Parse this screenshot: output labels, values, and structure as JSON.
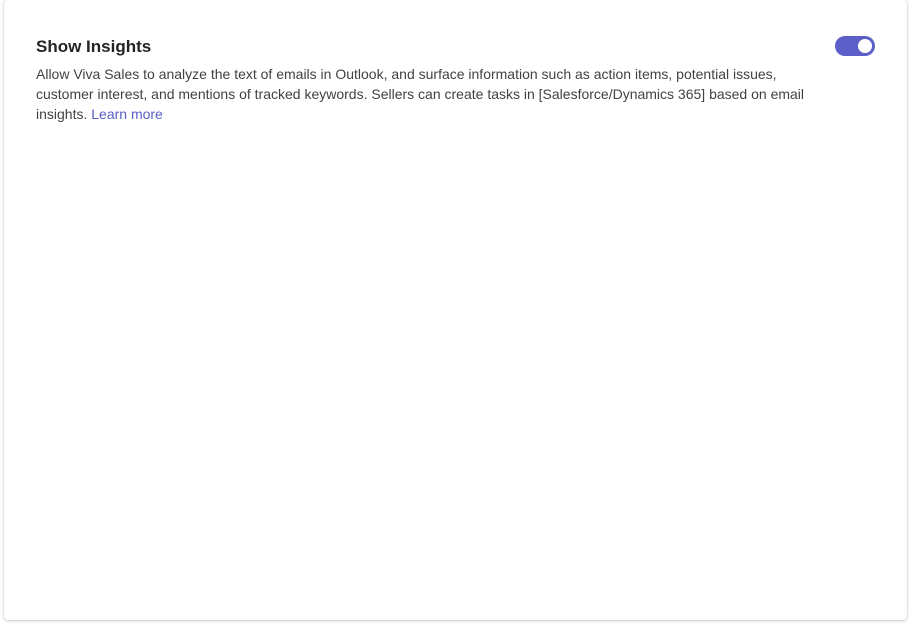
{
  "setting": {
    "title": "Show Insights",
    "description": "Allow Viva Sales to analyze the text of emails in Outlook, and surface information such as action items, potential issues, customer interest, and mentions of tracked keywords. Sellers can create tasks in [Salesforce/Dynamics 365] based on email insights.",
    "learn_more_label": "Learn more",
    "toggle_state": "on",
    "accent_color": "#5b5fc7"
  }
}
